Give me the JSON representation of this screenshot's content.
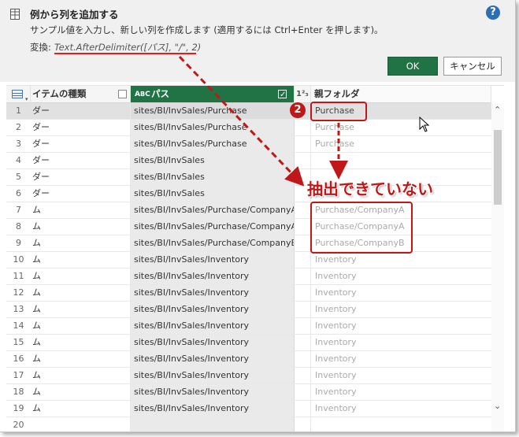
{
  "dialog": {
    "title": "例から列を追加する",
    "description": "サンプル値を入力し、新しい列を作成します (適用するには Ctrl+Enter を押します)。",
    "transform_label": "変換:",
    "transform_formula": "Text.AfterDelimiter([パス], \"/\", 2)",
    "ok_label": "OK",
    "cancel_label": "キャンセル",
    "help_icon": "?"
  },
  "grid": {
    "columns": {
      "type_header": "イテムの種類",
      "path_header": "パス",
      "path_type_icon": "ABC",
      "narrow_header": "1²₃",
      "new_header": "親フォルダ"
    },
    "rows": [
      {
        "num": "1",
        "type": "ダー",
        "path": "sites/BI/InvSales/Purchase",
        "new": "Purchase"
      },
      {
        "num": "2",
        "type": "ダー",
        "path": "sites/BI/InvSales/Purchase",
        "new": "Purchase"
      },
      {
        "num": "3",
        "type": "ダー",
        "path": "sites/BI/InvSales/Purchase",
        "new": "Purchase"
      },
      {
        "num": "4",
        "type": "ダー",
        "path": "sites/BI/InvSales",
        "new": ""
      },
      {
        "num": "5",
        "type": "ダー",
        "path": "sites/BI/InvSales",
        "new": ""
      },
      {
        "num": "6",
        "type": "ダー",
        "path": "sites/BI/InvSales",
        "new": ""
      },
      {
        "num": "7",
        "type": "ム",
        "path": "sites/BI/InvSales/Purchase/CompanyA",
        "new": "Purchase/CompanyA"
      },
      {
        "num": "8",
        "type": "ム",
        "path": "sites/BI/InvSales/Purchase/CompanyA",
        "new": "Purchase/CompanyA"
      },
      {
        "num": "9",
        "type": "ム",
        "path": "sites/BI/InvSales/Purchase/CompanyB",
        "new": "Purchase/CompanyB"
      },
      {
        "num": "10",
        "type": "ム",
        "path": "sites/BI/InvSales/Inventory",
        "new": "Inventory"
      },
      {
        "num": "11",
        "type": "ム",
        "path": "sites/BI/InvSales/Inventory",
        "new": "Inventory"
      },
      {
        "num": "12",
        "type": "ム",
        "path": "sites/BI/InvSales/Inventory",
        "new": "Inventory"
      },
      {
        "num": "13",
        "type": "ム",
        "path": "sites/BI/InvSales/Inventory",
        "new": "Inventory"
      },
      {
        "num": "14",
        "type": "ム",
        "path": "sites/BI/InvSales/Inventory",
        "new": "Inventory"
      },
      {
        "num": "15",
        "type": "ム",
        "path": "sites/BI/InvSales/Inventory",
        "new": "Inventory"
      },
      {
        "num": "16",
        "type": "ム",
        "path": "sites/BI/InvSales/Inventory",
        "new": "Inventory"
      },
      {
        "num": "17",
        "type": "ム",
        "path": "sites/BI/InvSales/Inventory",
        "new": "Inventory"
      },
      {
        "num": "18",
        "type": "ム",
        "path": "sites/BI/InvSales/Inventory",
        "new": "Inventory"
      },
      {
        "num": "19",
        "type": "ム",
        "path": "sites/BI/InvSales/Inventory",
        "new": "Inventory"
      },
      {
        "num": "20",
        "type": "",
        "path": "",
        "new": ""
      }
    ]
  },
  "annotation": {
    "step_number": "2",
    "note": "抽出できていない",
    "color": "#c01818"
  },
  "colors": {
    "accent_green": "#217346",
    "help_blue": "#2e6eb5"
  }
}
